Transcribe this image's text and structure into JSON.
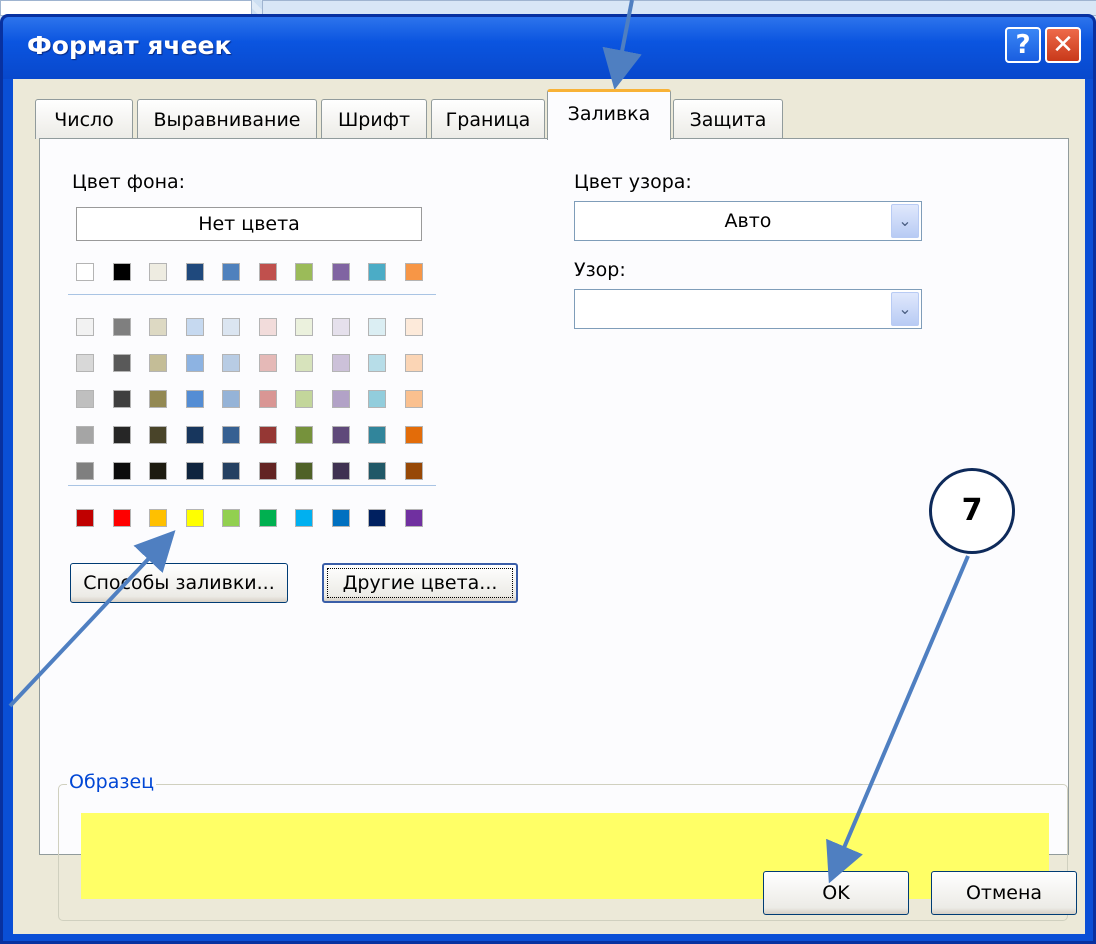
{
  "dialog": {
    "title": "Формат ячеек",
    "help_label": "?",
    "close_label": "✕"
  },
  "tabs": [
    {
      "label": "Число",
      "active": false
    },
    {
      "label": "Выравнивание",
      "active": false
    },
    {
      "label": "Шрифт",
      "active": false
    },
    {
      "label": "Граница",
      "active": false
    },
    {
      "label": "Заливка",
      "active": true
    },
    {
      "label": "Защита",
      "active": false
    }
  ],
  "fill": {
    "bg_color_label": "Цвет фона:",
    "no_color_label": "Нет цвета",
    "pattern_color_label": "Цвет узора:",
    "pattern_color_value": "Авто",
    "pattern_label": "Узор:",
    "pattern_value": "",
    "fill_effects_button": "Способы заливки...",
    "more_colors_button": "Другие цвета...",
    "sample_label": "Образец",
    "sample_color": "#ffff66"
  },
  "palette": {
    "theme_row": [
      "#ffffff",
      "#000000",
      "#eeece1",
      "#1f497d",
      "#4f81bd",
      "#c0504d",
      "#9bbb59",
      "#8064a2",
      "#4bacc6",
      "#f79646"
    ],
    "tint_rows": [
      [
        "#f2f2f2",
        "#7f7f7f",
        "#ddd9c3",
        "#c6d9f0",
        "#dbe5f1",
        "#f2dcdb",
        "#ebf1dd",
        "#e5e0ec",
        "#dbeef3",
        "#fdeada"
      ],
      [
        "#d8d8d8",
        "#595959",
        "#c4bd97",
        "#8db3e2",
        "#b8cce4",
        "#e5b9b7",
        "#d7e3bc",
        "#ccc1d9",
        "#b7dde8",
        "#fbd5b5"
      ],
      [
        "#bfbfbf",
        "#3f3f3f",
        "#938953",
        "#548dd4",
        "#95b3d7",
        "#d99694",
        "#c3d69b",
        "#b2a2c7",
        "#92cddc",
        "#fac08f"
      ],
      [
        "#a5a5a5",
        "#262626",
        "#494429",
        "#17365d",
        "#366092",
        "#953734",
        "#76923c",
        "#5f497a",
        "#31859b",
        "#e36c09"
      ],
      [
        "#7f7f7f",
        "#0c0c0c",
        "#1d1b10",
        "#0f243e",
        "#244061",
        "#632423",
        "#4f6128",
        "#3f3151",
        "#205867",
        "#974806"
      ]
    ],
    "standard_row": [
      "#c00000",
      "#ff0000",
      "#ffc000",
      "#ffff00",
      "#92d050",
      "#00b050",
      "#00b0f0",
      "#0070c0",
      "#002060",
      "#7030a0"
    ]
  },
  "buttons": {
    "ok": "OK",
    "cancel": "Отмена"
  },
  "annotation": {
    "step_number": "7",
    "arrow_color": "#4f7fc1"
  }
}
